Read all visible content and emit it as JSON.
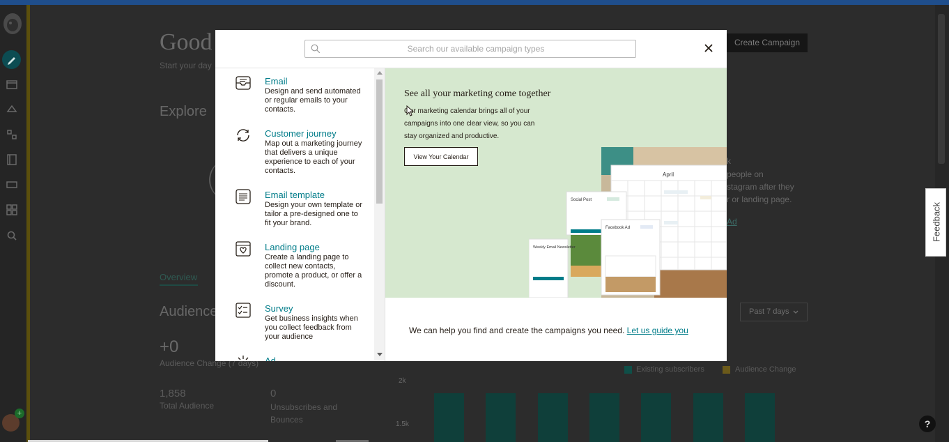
{
  "background": {
    "title": "Good",
    "subtitle": "Start your day",
    "explore": "Explore",
    "create_campaign": "Create Campaign",
    "promo_lines": [
      "k",
      "people on",
      "stagram after they",
      "r or landing page."
    ],
    "promo_link": "Ad",
    "overview_tab": "Overview",
    "audience_heading": "Audience",
    "audience_change_value": "+0",
    "audience_change_label": "Audience Change",
    "audience_change_period": "(7 days)",
    "total_audience_value": "1,858",
    "total_audience_label": "Total Audience",
    "unsub_value": "0",
    "unsub_label": "Unsubscribes and Bounces",
    "filter": "Past 7 days",
    "chart_legend": [
      "Existing subscribers",
      "Audience Change"
    ],
    "chart_axis": [
      "2k",
      "1.5k"
    ],
    "chart_bars": [
      1,
      1,
      1,
      1,
      1,
      1,
      1
    ],
    "feedback": "Feedback",
    "help": "?"
  },
  "modal": {
    "search_placeholder": "Search our available campaign types",
    "campaign_types": [
      {
        "icon": "email-icon",
        "name": "Email",
        "description": "Design and send automated or regular emails to your contacts."
      },
      {
        "icon": "customer-journey-icon",
        "name": "Customer journey",
        "description": "Map out a marketing journey that delivers a unique experience to each of your contacts."
      },
      {
        "icon": "email-template-icon",
        "name": "Email template",
        "description": "Design your own template or tailor a pre-designed one to fit your brand."
      },
      {
        "icon": "landing-page-icon",
        "name": "Landing page",
        "description": "Create a landing page to collect new contacts, promote a product, or offer a discount."
      },
      {
        "icon": "survey-icon",
        "name": "Survey",
        "description": "Get business insights when you collect feedback from your audience"
      },
      {
        "icon": "ad-icon",
        "name": "Ad",
        "description": ""
      }
    ],
    "promo": {
      "title": "See all your marketing come together",
      "body": "Our marketing calendar brings all of your campaigns into one clear view, so you can stay organized and productive.",
      "button": "View Your Calendar",
      "calendar_month": "April",
      "card_social": "Social Post",
      "card_facebook": "Facebook Ad",
      "card_newsletter": "Weekly Email Newsletter"
    },
    "guide_text": "We can help you find and create the campaigns you need.",
    "guide_link": "Let us guide you"
  },
  "colors": {
    "accent_teal": "#007c89",
    "promo_bg": "#d6e8cf",
    "bar_fill": "#0f3f3a",
    "legend_existing": "#0f4f48",
    "legend_change": "#6b5a1a"
  }
}
